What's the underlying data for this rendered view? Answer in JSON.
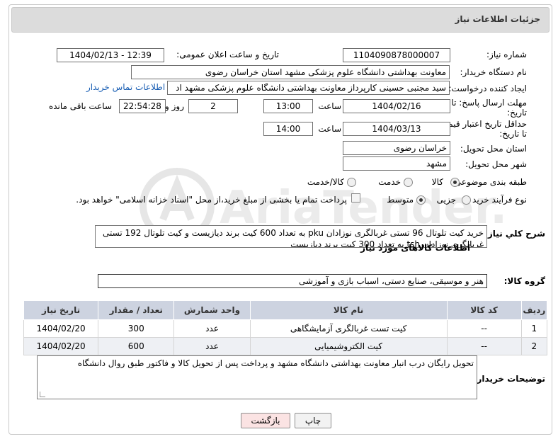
{
  "header": {
    "title": "جزئیات اطلاعات نیاز"
  },
  "fields": {
    "need_number": {
      "label": "شماره نیاز:",
      "value": "1104090878000007"
    },
    "announce": {
      "label": "تاریخ و ساعت اعلان عمومی:",
      "value": "1404/02/13 - 12:39"
    },
    "buyer_org": {
      "label": "نام دستگاه خریدار:",
      "value": "معاونت بهداشتی دانشگاه علوم پزشکی مشهد استان خراسان رضوی"
    },
    "requester": {
      "label": "ایجاد کننده درخواست:",
      "value": "سید مجتبی حسینی کارپرداز معاونت بهداشتی دانشگاه علوم پزشکی مشهد اد",
      "link": "اطلاعات تماس خریدار"
    },
    "deadline": {
      "label": "مهلت ارسال پاسخ: تا تاریخ:",
      "date": "1404/02/16",
      "time_label": "ساعت",
      "time": "13:00",
      "days": "2",
      "days_label": "روز و",
      "remaining": "22:54:28",
      "remaining_label": "ساعت باقی مانده"
    },
    "validity": {
      "label": "حداقل تاریخ اعتبار قیمت: تا تاریخ:",
      "date": "1404/03/13",
      "time_label": "ساعت",
      "time": "14:00"
    },
    "province": {
      "label": "استان محل تحویل:",
      "value": "خراسان رضوی"
    },
    "city": {
      "label": "شهر محل تحویل:",
      "value": "مشهد"
    },
    "category": {
      "label": "طبقه بندی موضوعی:",
      "options": [
        "کالا",
        "خدمت",
        "کالا/خدمت"
      ]
    },
    "process": {
      "label": "نوع فرآیند خرید :",
      "options": [
        "جزیی",
        "متوسط"
      ],
      "note": "پرداخت تمام یا بخشی از مبلغ خرید،از محل \"اسناد خزانه اسلامی\" خواهد بود."
    }
  },
  "description": {
    "label": "شرح کلي نياز:",
    "text": "خرید کیت تلوتال 96 تستی غربالگری نوزادان pku به تعداد 600 کیت برند دیازیست و کیت تلوتال 192 تستی غربالگری نوزادان tsh به تعداد 300 کیت برند دیازیست"
  },
  "goods_section": {
    "title": "اطلاعات کالاهای مورد نیاز",
    "group_label": "گروه کالا:",
    "group_value": "هنر و موسیقی، صنایع دستی، اسباب بازی و آموزشی"
  },
  "table": {
    "headers": [
      "ردیف",
      "کد کالا",
      "نام کالا",
      "واحد شمارش",
      "تعداد / مقدار",
      "تاریخ نیاز"
    ],
    "rows": [
      [
        "1",
        "--",
        "کیت تست غربالگری آزمایشگاهی",
        "عدد",
        "300",
        "1404/02/20"
      ],
      [
        "2",
        "--",
        "کیت الکتروشیمیایی",
        "عدد",
        "600",
        "1404/02/20"
      ]
    ]
  },
  "buyer_notes": {
    "label": "توضیحات خریدار:",
    "text": "تحویل رایگان درب انبار معاونت بهداشتی دانشگاه مشهد و پرداخت پس از تحویل کالا و فاکتور طبق روال دانشگاه"
  },
  "buttons": {
    "print": "چاپ",
    "back": "بازگشت"
  },
  "watermark": {
    "text": "AriaTender.neT"
  }
}
